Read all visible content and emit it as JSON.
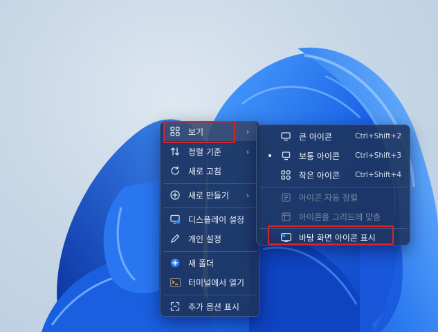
{
  "colors": {
    "menu_bg": "#1e325a",
    "text": "#eef2f8",
    "disabled_text": "#7e8aa3",
    "highlight_border": "#d8232a",
    "bloom_blue": "#1565e8"
  },
  "context_menu": {
    "items": [
      {
        "label": "보기",
        "icon": "view-grid-icon",
        "has_submenu": true,
        "highlighted": true
      },
      {
        "label": "정렬 기준",
        "icon": "sort-arrows-icon",
        "has_submenu": true
      },
      {
        "label": "새로 고침",
        "icon": "refresh-icon"
      },
      {
        "label": "새로 만들기",
        "icon": "add-circle-icon",
        "has_submenu": true
      },
      {
        "label": "디스플레이 설정",
        "icon": "display-settings-icon"
      },
      {
        "label": "개인 설정",
        "icon": "pen-icon"
      },
      {
        "label": "새 폴더",
        "icon": "new-folder-icon"
      },
      {
        "label": "터미널에서 열기",
        "icon": "terminal-icon"
      },
      {
        "label": "추가 옵션 표시",
        "icon": "more-options-icon"
      }
    ]
  },
  "view_submenu": {
    "items": [
      {
        "label": "큰 아이콘",
        "icon": "large-icons-icon",
        "shortcut": "Ctrl+Shift+2"
      },
      {
        "label": "보통 아이콘",
        "icon": "medium-icons-icon",
        "shortcut": "Ctrl+Shift+3",
        "selected": true
      },
      {
        "label": "작은 아이콘",
        "icon": "small-icons-icon",
        "shortcut": "Ctrl+Shift+4"
      },
      {
        "label": "아이콘 자동 정렬",
        "icon": "auto-arrange-icon",
        "disabled": true
      },
      {
        "label": "아이콘을 그리드에 맞춤",
        "icon": "align-grid-icon",
        "disabled": true
      },
      {
        "label": "바탕 화면 아이콘 표시",
        "icon": "show-desktop-icons-icon",
        "highlighted": true
      }
    ]
  }
}
